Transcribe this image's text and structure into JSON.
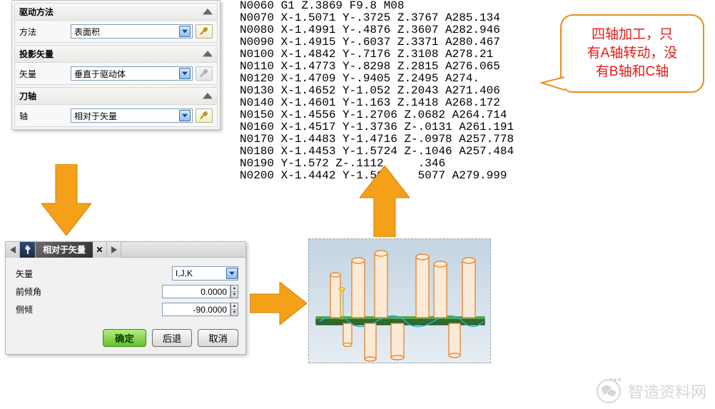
{
  "panel": {
    "section1": {
      "title": "驱动方法",
      "row_label": "方法",
      "value": "表面积"
    },
    "section2": {
      "title": "投影矢量",
      "row_label": "矢量",
      "value": "垂直于驱动体"
    },
    "section3": {
      "title": "刀轴",
      "row_label": "轴",
      "value": "相对于矢量"
    }
  },
  "gcode": "N0060 G1 Z.3869 F9.8 M08\nN0070 X-1.5071 Y-.3725 Z.3767 A285.134\nN0080 X-1.4991 Y-.4876 Z.3607 A282.946\nN0090 X-1.4915 Y-.6037 Z.3371 A280.467\nN0100 X-1.4842 Y-.7176 Z.3108 A278.21\nN0110 X-1.4773 Y-.8298 Z.2815 A276.065\nN0120 X-1.4709 Y-.9405 Z.2495 A274.\nN0130 X-1.4652 Y-1.052 Z.2043 A271.406\nN0140 X-1.4601 Y-1.163 Z.1418 A268.172\nN0150 X-1.4556 Y-1.2706 Z.0682 A264.714\nN0160 X-1.4517 Y-1.3736 Z-.0131 A261.191\nN0170 X-1.4483 Y-1.4716 Z-.0978 A257.778\nN0180 X-1.4453 Y-1.5724 Z-.1046 A257.484\nN0190 Y-1.572 Z-.1112     .346\nN0200 X-1.4442 Y-1.503    5077 A279.999",
  "callout": {
    "line1": "四轴加工，只",
    "line2": "有A轴转动，没",
    "line3": "有B轴和C轴"
  },
  "dialog": {
    "title": "相对于矢量",
    "vector_label": "矢量",
    "vector_value": "I,J,K",
    "lead_label": "前倾角",
    "lead_value": "0.0000",
    "tilt_label": "侧倾",
    "tilt_value": "-90.0000",
    "ok": "确定",
    "back": "后退",
    "cancel": "取消"
  },
  "watermark": "智造资料网"
}
